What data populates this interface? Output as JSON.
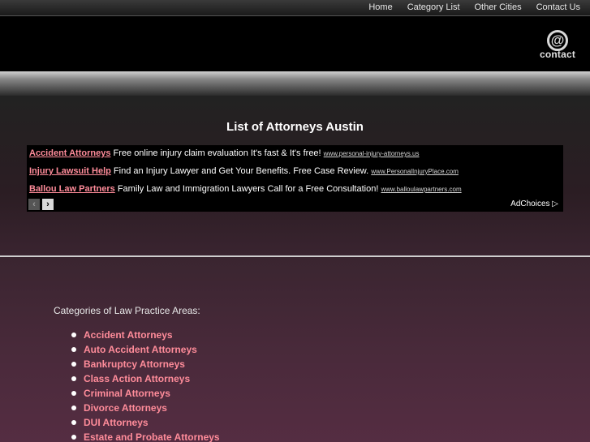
{
  "nav": [
    "Home",
    "Category List",
    "Other Cities",
    "Contact Us"
  ],
  "logo": {
    "symbol": "@",
    "text": "contact"
  },
  "page_title": "List of Attorneys Austin",
  "ads": [
    {
      "title": "Accident Attorneys",
      "text": "Free online injury claim evaluation It's fast & It's free!",
      "url": "www.personal-injury-attorneys.us"
    },
    {
      "title": "Injury Lawsuit Help",
      "text": "Find an Injury Lawyer and Get Your Benefits. Free Case Review.",
      "url": "www.PersonalInjuryPlace.com"
    },
    {
      "title": "Ballou Law Partners",
      "text": "Family Law and Immigration Lawyers Call for a Free Consultation!",
      "url": "www.balloulawpartners.com"
    }
  ],
  "adchoices": "AdChoices ▷",
  "ad_nav": {
    "prev": "‹",
    "next": "›"
  },
  "categories_heading": "Categories of Law Practice Areas:",
  "categories": [
    "Accident Attorneys",
    "Auto Accident Attorneys",
    "Bankruptcy Attorneys",
    "Class Action Attorneys",
    "Criminal Attorneys",
    "Divorce Attorneys",
    "DUI Attorneys",
    "Estate and Probate Attorneys"
  ],
  "colors": {
    "link": "#ff8c9a",
    "background": "#000000"
  }
}
